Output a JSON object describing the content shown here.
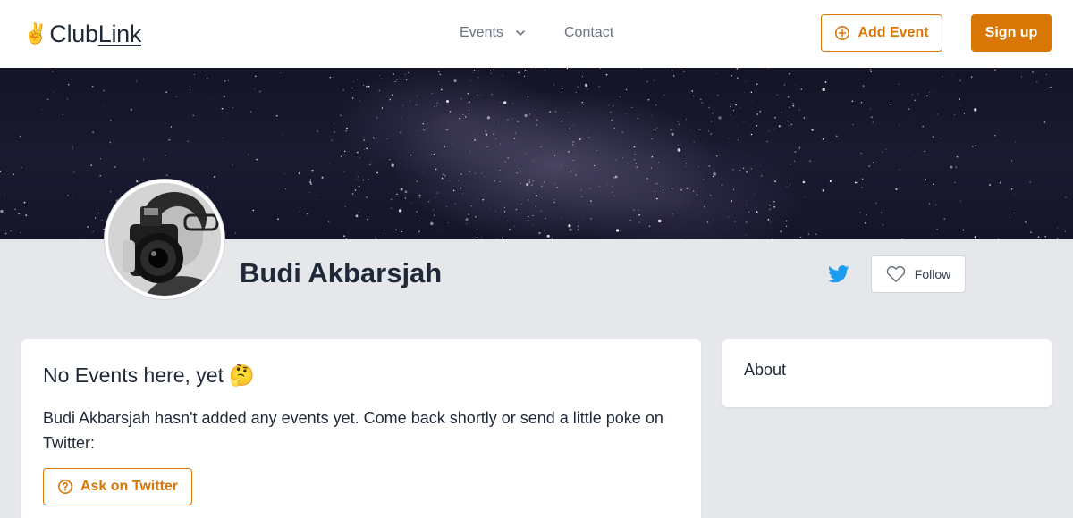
{
  "header": {
    "logo_emoji": "✌️",
    "logo_text_part1": "Club",
    "logo_text_part2": "Link",
    "nav": {
      "events_label": "Events",
      "contact_label": "Contact"
    },
    "add_event_label": "Add Event",
    "signup_label": "Sign up"
  },
  "profile": {
    "name": "Budi Akbarsjah",
    "follow_label": "Follow"
  },
  "events_card": {
    "title": "No Events here, yet 🤔",
    "message": "Budi Akbarsjah hasn't added any events yet. Come back shortly or send a little poke on Twitter:",
    "ask_label": "Ask on Twitter"
  },
  "about_card": {
    "title": "About"
  },
  "colors": {
    "accent": "#d97706",
    "background": "#e5e7eb",
    "twitter": "#1d9bf0"
  },
  "icons": {
    "events_dropdown": "chevron-down-icon",
    "add_event": "plus-circle-icon",
    "twitter": "twitter-bird-icon",
    "follow": "heart-outline-icon",
    "ask": "question-circle-icon"
  }
}
